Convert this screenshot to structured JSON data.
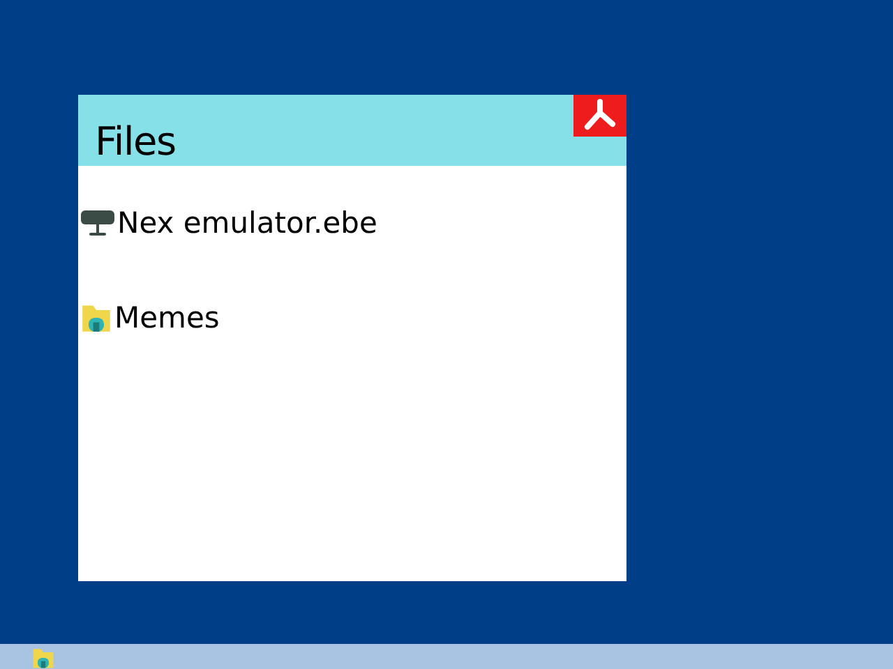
{
  "window": {
    "title": "Files"
  },
  "files": [
    {
      "name": "Nex emulator.ebe",
      "kind": "program"
    },
    {
      "name": "Memes",
      "kind": "folder"
    }
  ],
  "taskbar": {
    "items": [
      {
        "kind": "folder"
      }
    ]
  }
}
